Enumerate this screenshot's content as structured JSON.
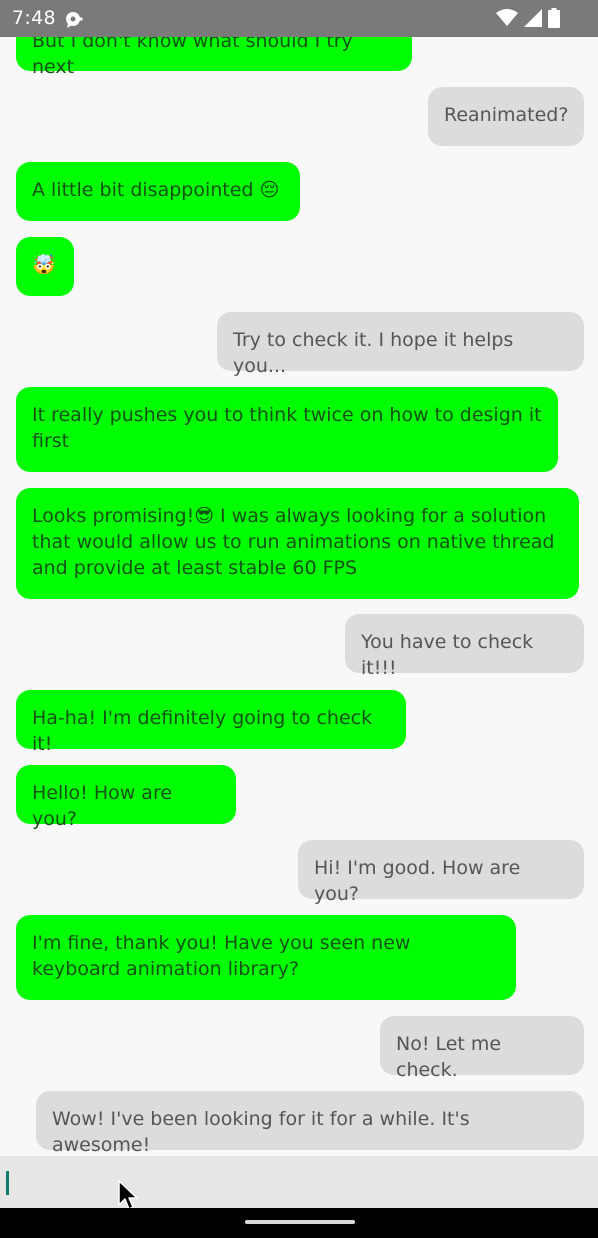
{
  "status_bar": {
    "time": "7:48",
    "notification_icon": "chat-notification-icon",
    "icons": [
      "wifi-icon",
      "signal-icon",
      "battery-icon"
    ]
  },
  "colors": {
    "incoming_bubble": "#00ff00",
    "outgoing_bubble": "#dcdcdc",
    "caret": "#0d7d6b"
  },
  "messages": [
    {
      "side": "left",
      "text": "But I don't know what should I try next"
    },
    {
      "side": "right",
      "text": "Reanimated?"
    },
    {
      "side": "left",
      "text": "A little bit disappointed 😔"
    },
    {
      "side": "left",
      "text": "🤯"
    },
    {
      "side": "right",
      "text": "Try to check it. I hope it helps you..."
    },
    {
      "side": "left",
      "text": "It really pushes you to think twice on how to design it first"
    },
    {
      "side": "left",
      "text": "Looks promising!😎 I was always looking for a solution that would allow us to run animations on native thread and provide at least stable 60 FPS"
    },
    {
      "side": "right",
      "text": "You have to check it!!!"
    },
    {
      "side": "left",
      "text": "Ha-ha! I'm definitely going to check it!"
    },
    {
      "side": "left",
      "text": "Hello! How are you?"
    },
    {
      "side": "right",
      "text": "Hi! I'm good. How are you?"
    },
    {
      "side": "left",
      "text": "I'm fine, thank you! Have you seen new keyboard animation library?"
    },
    {
      "side": "right",
      "text": "No! Let me check."
    },
    {
      "side": "right",
      "text": "Wow! I've been looking for it for a while. It's awesome!"
    }
  ],
  "composer": {
    "value": "",
    "placeholder": ""
  }
}
